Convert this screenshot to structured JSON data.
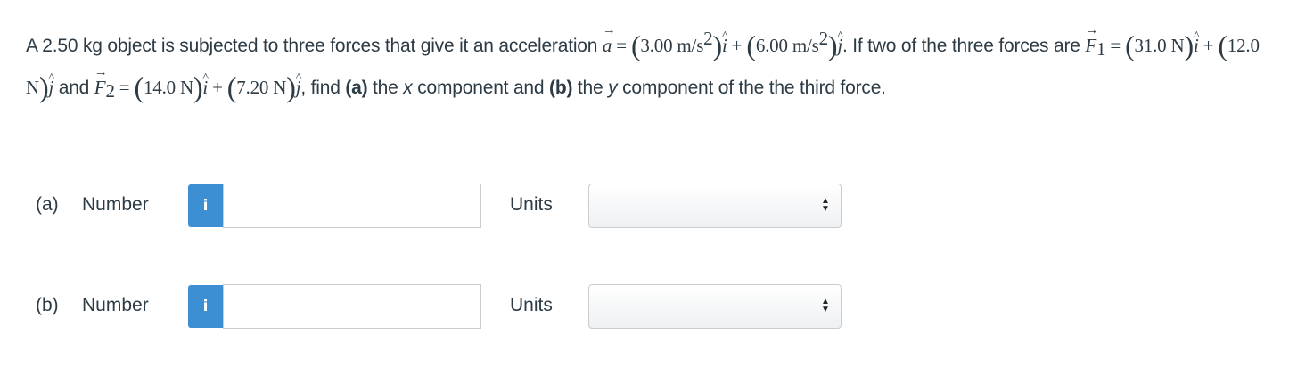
{
  "problem": {
    "t1": "A 2.50 kg object is subjected to three forces that give it an acceleration ",
    "a_sym": "a",
    "eq": " = ",
    "ax": "3.00 m/s",
    "sq": "2",
    "i_hat": "i",
    "plus": " + ",
    "ay": "6.00 m/s",
    "j_hat": "j",
    "t2": ". If two of the three forces are ",
    "F_sym": "F",
    "sub1": "1",
    "f1x": "31.0 N",
    "f1y": "12.0 N",
    "and": " and ",
    "sub2": "2",
    "f2x": "14.0 N",
    "f2y": "7.20 N",
    "t3": ", find ",
    "bold_a": "(a)",
    "t4": " the ",
    "x": "x",
    "t5": " component and ",
    "bold_b": "(b)",
    "y": "y",
    "t6": " component of the the third force."
  },
  "rows": [
    {
      "part": "(a)",
      "number_label": "Number",
      "info_icon": "i",
      "units_label": "Units",
      "value": "",
      "unit_selected": ""
    },
    {
      "part": "(b)",
      "number_label": "Number",
      "info_icon": "i",
      "units_label": "Units",
      "value": "",
      "unit_selected": ""
    }
  ],
  "colors": {
    "info_button": "#3d8fd4",
    "text": "#2d3b45",
    "border": "#c7cdd1"
  },
  "icons": {
    "info": "info-icon",
    "select_arrows": "up-down-arrows-icon"
  }
}
